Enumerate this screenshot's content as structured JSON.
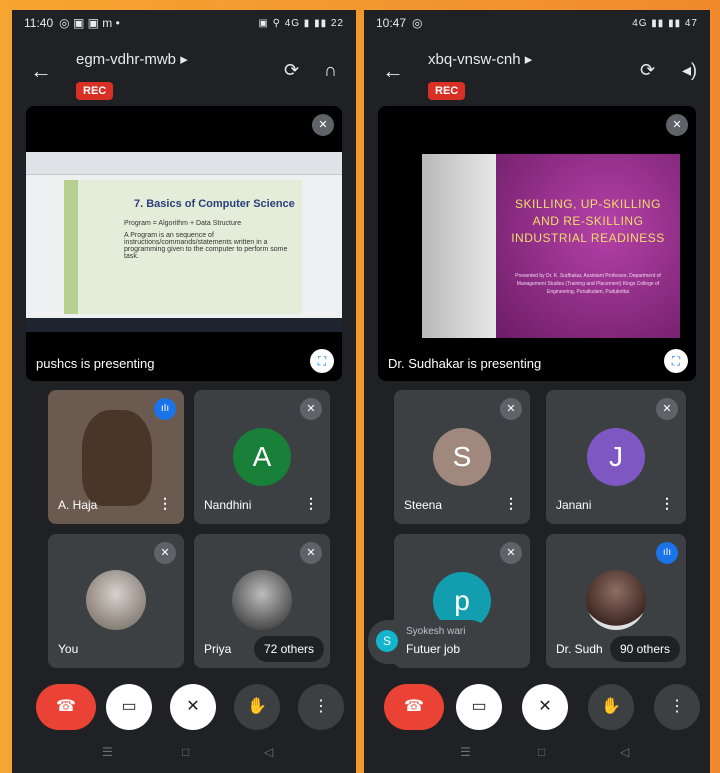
{
  "left": {
    "status_time": "11:40",
    "status_icons": "◎ ▣ ▣ m •",
    "status_right": "▣ ⚲ 4G ▮ ▮▮ 22",
    "meeting_code": "egm-vdhr-mwb",
    "rec_label": "REC",
    "presenting_caption": "pushcs is presenting",
    "slide_title": "7. Basics of Computer Science",
    "slide_line1": "Program = Algorithm + Data Structure",
    "slide_line2": "A Program is an sequence of instructions/commands/statements written in a programming given to the computer to perform some task.",
    "tiles": [
      {
        "name": "A. Haja"
      },
      {
        "name": "Nandhini",
        "initial": "A"
      },
      {
        "name": "You"
      },
      {
        "name": "Priya",
        "others": "72 others"
      }
    ]
  },
  "right": {
    "status_time": "10:47",
    "status_icons": "◎",
    "status_right": "4G ▮▮ ▮▮ 47",
    "meeting_code": "xbq-vnsw-cnh",
    "rec_label": "REC",
    "presenting_caption": "Dr. Sudhakar is presenting",
    "slide_title_1": "SKILLING, UP-SKILLING",
    "slide_title_2": "AND RE-SKILLING",
    "slide_title_3": "INDUSTRIAL READINESS",
    "slide_small": "Presented by Dr. K. Sudhakar, Assistant Professor, Department of Management Studies (Training and Placement) Kings College of Engineering, Punalkulam, Pudukottai",
    "tiles": [
      {
        "name": "Steena",
        "initial": "S"
      },
      {
        "name": "Janani",
        "initial": "J"
      },
      {
        "name": "",
        "initial": "p"
      },
      {
        "name": "Dr. Sudh",
        "others": "90 others"
      }
    ],
    "toast": {
      "initial": "S",
      "name": "Syokesh wari",
      "message": "Futuer job"
    }
  },
  "colors": {
    "end_call": "#ea4335",
    "rec": "#d93025",
    "speaking": "#1a73e8",
    "tile_bg": "#3c4043"
  },
  "icons": [
    "arrow-left-icon",
    "flip-camera-icon",
    "headphones-icon",
    "speaker-icon",
    "mic-off-icon",
    "expand-icon",
    "more-vert-icon",
    "end-call-icon",
    "camera-off-icon",
    "raise-hand-icon",
    "audio-wave-icon"
  ]
}
